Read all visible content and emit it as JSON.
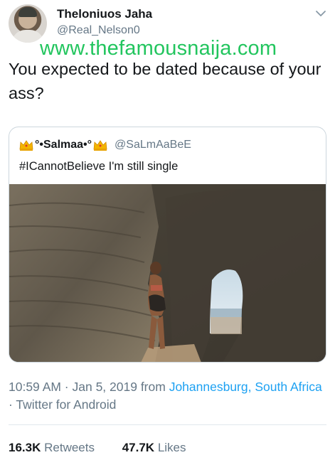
{
  "tweet": {
    "author_name": "Theloniuos Jaha",
    "author_handle": "@Real_Nelson0",
    "text": "You expected to be dated because of your ass?",
    "icons": {
      "menu": "chevron-down-icon",
      "avatar": "avatar"
    }
  },
  "watermark": "www.thefamousnaija.com",
  "quoted_tweet": {
    "author_name": "°•Salmaa•°",
    "author_handle": "@SaLmAaBeE",
    "text": "#ICannotBelieve I'm still single",
    "name_icons": [
      "crown-icon",
      "crown-icon"
    ]
  },
  "meta": {
    "time_date": "10:59 AM · Jan 5, 2019 from ",
    "location": "Johannesburg, South Africa",
    "separator": " · ",
    "client": "Twitter for Android"
  },
  "stats": {
    "retweets_count": "16.3K",
    "retweets_label": "Retweets",
    "likes_count": "47.7K",
    "likes_label": "Likes"
  },
  "colors": {
    "link": "#1da1f2",
    "secondary_text": "#657786",
    "watermark": "#22c55e",
    "border": "#ccd6dd"
  }
}
